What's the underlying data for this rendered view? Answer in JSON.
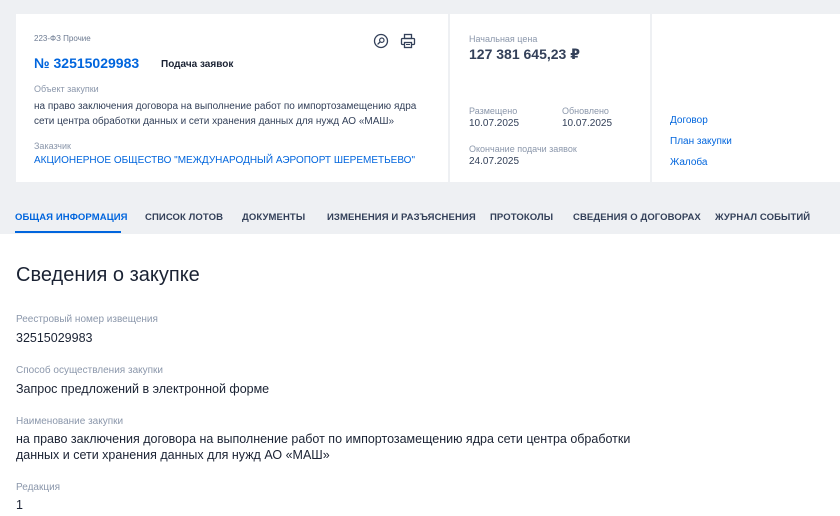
{
  "header": {
    "law_tag": "223-ФЗ Прочие",
    "purchase_number": "№ 32515029983",
    "stage": "Подача заявок",
    "object_label": "Объект закупки",
    "object_text": "на право заключения договора на выполнение работ по импортозамещению ядра сети центра обработки данных и сети хранения данных для нужд АО «МАШ»",
    "customer_label": "Заказчик",
    "customer_name": "АКЦИОНЕРНОЕ ОБЩЕСТВО \"МЕЖДУНАРОДНЫЙ АЭРОПОРТ ШЕРЕМЕТЬЕВО\"",
    "icons": {
      "search": "search-icon",
      "print": "printer-icon"
    }
  },
  "price_card": {
    "start_price_label": "Начальная цена",
    "start_price": "127 381 645,23 ₽",
    "placed_label": "Размещено",
    "placed_date": "10.07.2025",
    "updated_label": "Обновлено",
    "updated_date": "10.07.2025",
    "deadline_label": "Окончание подачи заявок",
    "deadline_date": "24.07.2025"
  },
  "side_links": {
    "contract": "Договор",
    "plan": "План закупки",
    "complaint": "Жалоба"
  },
  "tabs": [
    {
      "label": "ОБЩАЯ ИНФОРМАЦИЯ",
      "active": true
    },
    {
      "label": "СПИСОК ЛОТОВ"
    },
    {
      "label": "ДОКУМЕНТЫ"
    },
    {
      "label": "ИЗМЕНЕНИЯ И РАЗЪЯСНЕНИЯ"
    },
    {
      "label": "ПРОТОКОЛЫ"
    },
    {
      "label": "СВЕДЕНИЯ О ДОГОВОРАХ"
    },
    {
      "label": "ЖУРНАЛ СОБЫТИЙ"
    }
  ],
  "section": {
    "title": "Сведения о закупке",
    "fields": [
      {
        "label": "Реестровый номер извещения",
        "value": "32515029983"
      },
      {
        "label": "Способ осуществления закупки",
        "value": "Запрос предложений в электронной форме"
      },
      {
        "label": "Наименование закупки",
        "value": "на право заключения договора на выполнение работ по импортозамещению ядра сети центра обработки данных и сети хранения данных для нужд АО «МАШ»"
      },
      {
        "label": "Редакция",
        "value": "1"
      }
    ]
  },
  "colors": {
    "accent": "#0065dd",
    "band": "#eef0f3",
    "text": "#334059",
    "muted": "#8b97ab"
  }
}
